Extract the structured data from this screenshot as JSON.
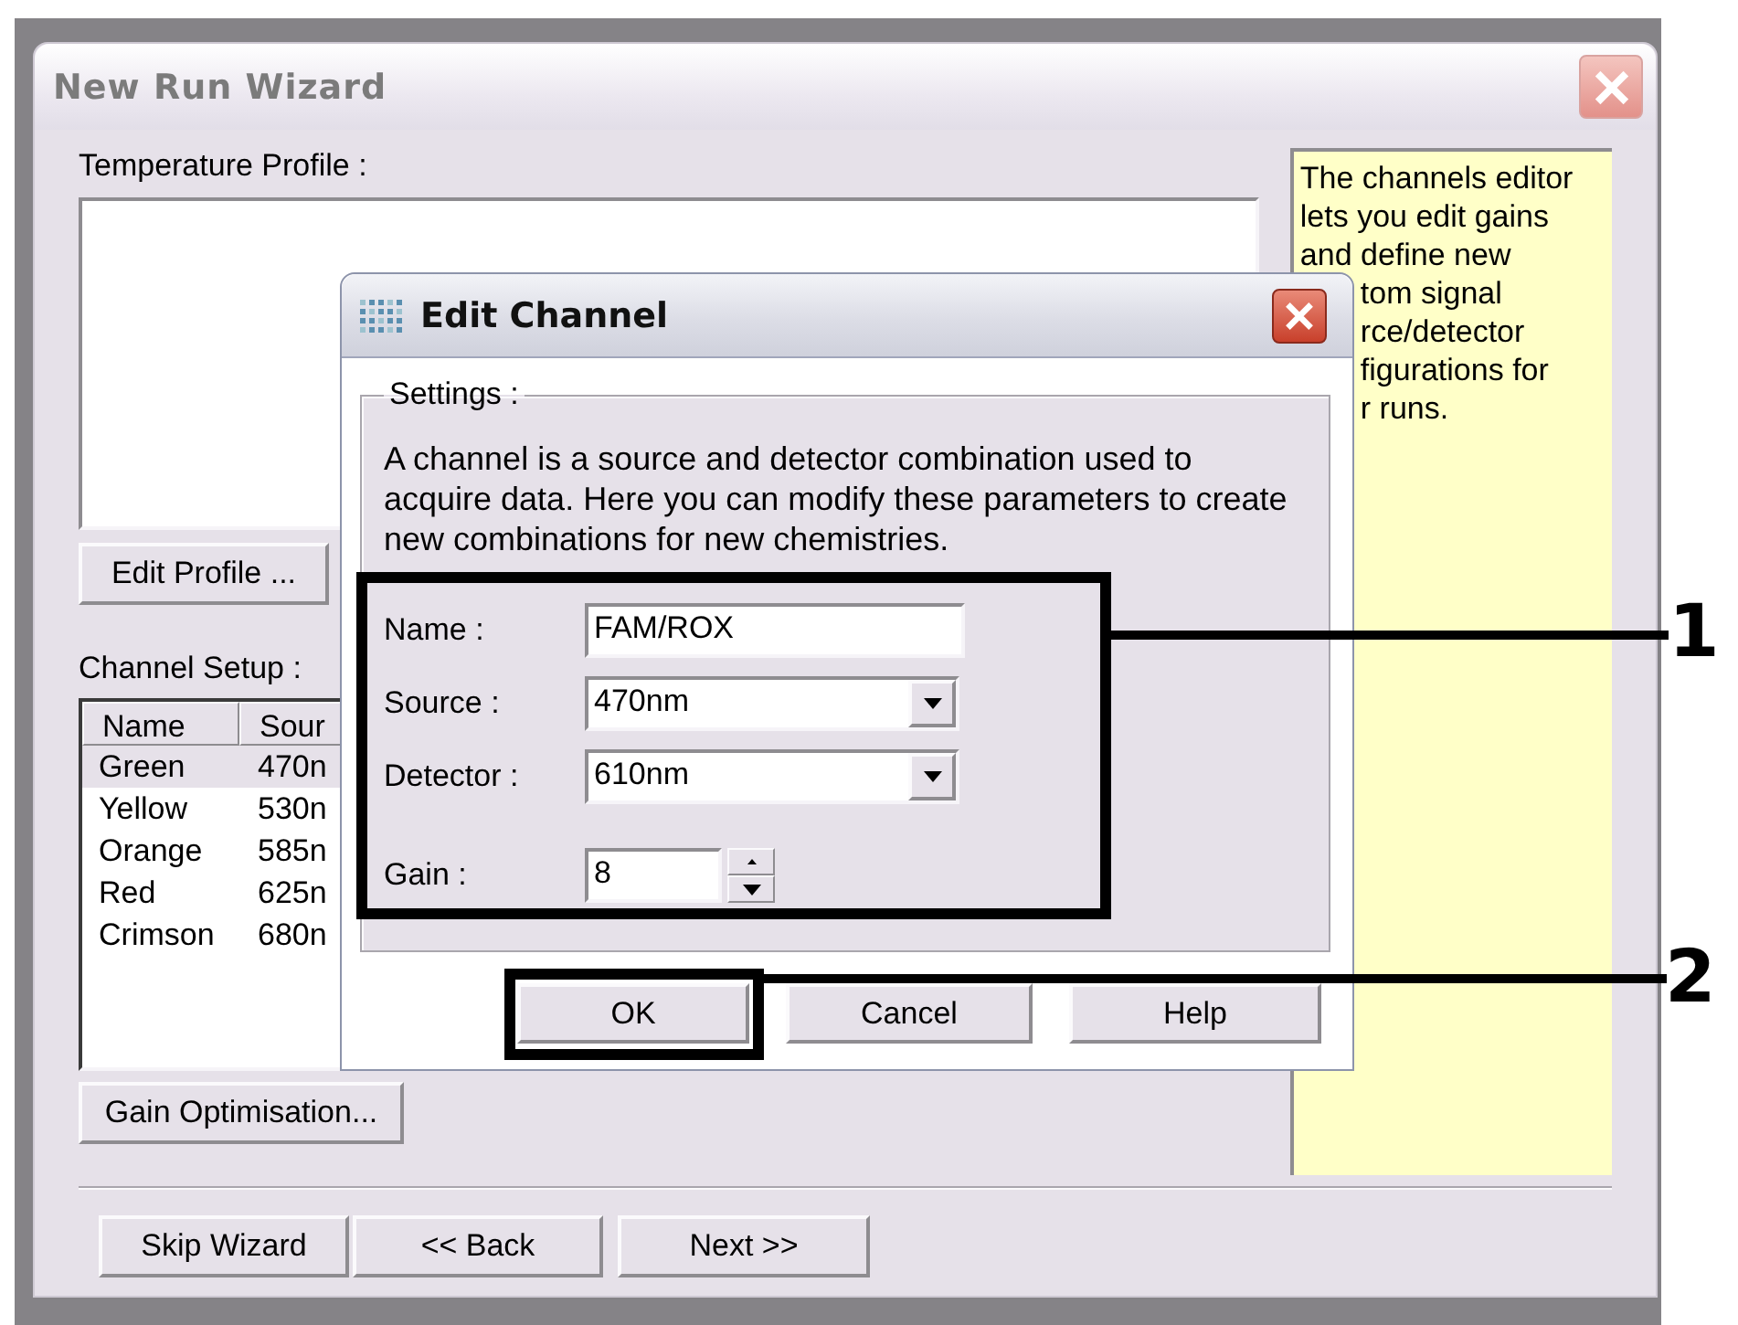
{
  "window": {
    "title": "New Run Wizard"
  },
  "temperature_profile": {
    "label": "Temperature Profile :",
    "button": "Edit Profile ..."
  },
  "channel_setup": {
    "label": "Channel Setup :",
    "columns": [
      "Name",
      "Sour"
    ],
    "rows": [
      {
        "name": "Green",
        "source": "470n",
        "selected": true
      },
      {
        "name": "Yellow",
        "source": "530n",
        "selected": false
      },
      {
        "name": "Orange",
        "source": "585n",
        "selected": false
      },
      {
        "name": "Red",
        "source": "625n",
        "selected": false
      },
      {
        "name": "Crimson",
        "source": "680n",
        "selected": false
      }
    ],
    "button": "Gain Optimisation..."
  },
  "help_panel": {
    "lines": [
      {
        "text": "The channels editor",
        "kind": "full"
      },
      {
        "text": "lets you edit gains",
        "kind": "full"
      },
      {
        "text": "and define new",
        "kind": "full"
      },
      {
        "text": "tom signal",
        "kind": "cut"
      },
      {
        "text": "rce/detector",
        "kind": "cut"
      },
      {
        "text": "figurations for",
        "kind": "cut"
      },
      {
        "text": "r runs.",
        "kind": "cut"
      }
    ]
  },
  "footer_buttons": [
    "Skip Wizard",
    "<< Back",
    "Next >>"
  ],
  "dialog": {
    "title": "Edit Channel",
    "group_label": "Settings :",
    "description": "A channel is a source and detector combination used to acquire data. Here you can modify these parameters to create new combinations for new chemistries.",
    "fields": [
      {
        "label": "Name :",
        "kind": "text",
        "value": "FAM/ROX"
      },
      {
        "label": "Source :",
        "kind": "select",
        "value": "470nm"
      },
      {
        "label": "Detector :",
        "kind": "select",
        "value": "610nm"
      },
      {
        "label": "Gain :",
        "kind": "spin",
        "value": "8"
      }
    ],
    "buttons": [
      "OK",
      "Cancel",
      "Help"
    ]
  },
  "callouts": [
    {
      "label": "1"
    },
    {
      "label": "2"
    }
  ]
}
